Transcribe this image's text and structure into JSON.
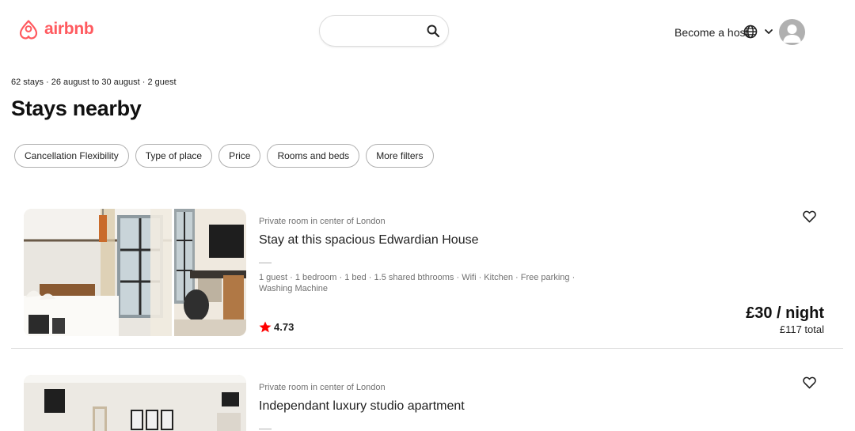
{
  "header": {
    "brand": "airbnb",
    "host_label": "Become a host",
    "colors": {
      "brand": "#ff5a5f",
      "rating_star": "#ff0000"
    }
  },
  "summary": "62 stays · 26 august to 30 august · 2 guest",
  "page_title": "Stays nearby",
  "filters": [
    "Cancellation Flexibility",
    "Type of place",
    "Price",
    "Rooms and beds",
    "More filters"
  ],
  "listings": [
    {
      "subtype": "Private room in center of London",
      "title": "Stay at this spacious Edwardian House",
      "amenities": "1 guest · 1 bedroom · 1 bed · 1.5 shared bthrooms · Wifi · Kitchen · Free parking · Washing Machine",
      "rating": "4.73",
      "price": "£30 / night",
      "total": "£117 total"
    },
    {
      "subtype": "Private room in center of London",
      "title": "Independant luxury studio apartment"
    }
  ]
}
